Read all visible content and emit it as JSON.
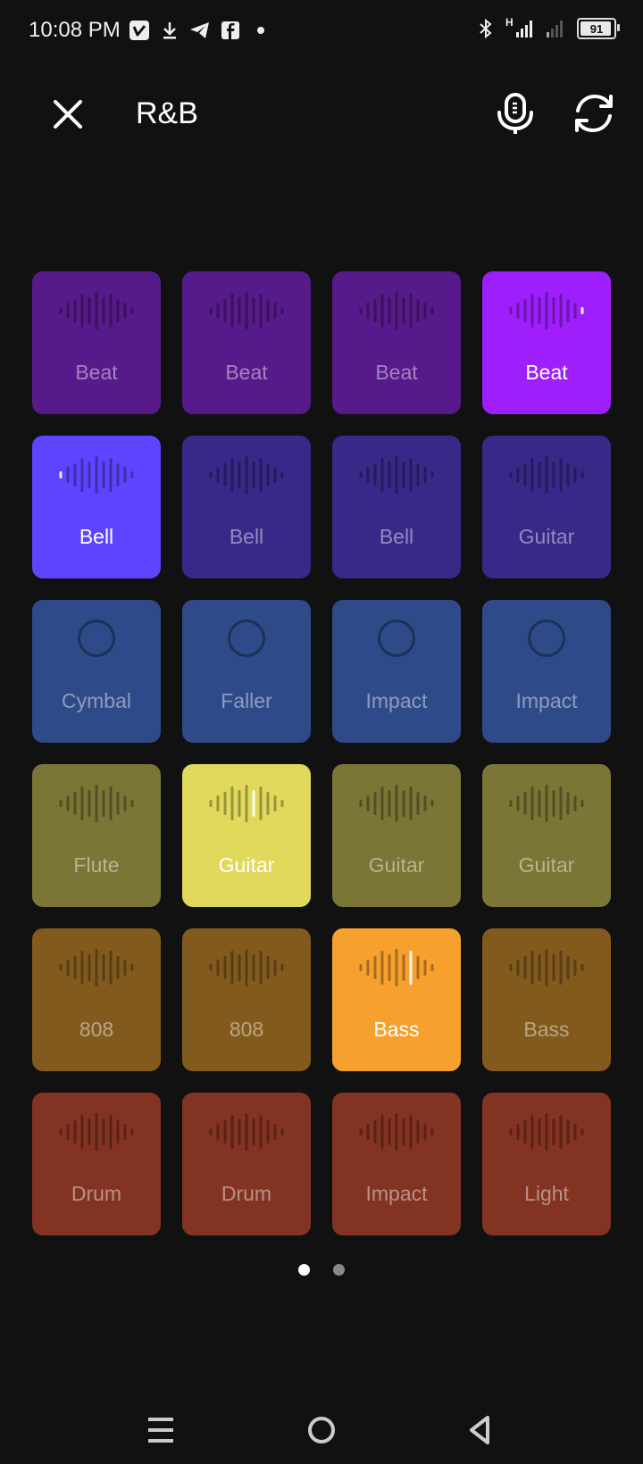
{
  "status_bar": {
    "time": "10:08 PM",
    "left_icons": [
      "vimeo-icon",
      "download-icon",
      "telegram-icon",
      "facebook-icon",
      "dot-icon"
    ],
    "network": "H",
    "battery": "91"
  },
  "header": {
    "title": "R&B",
    "close_icon": "close-icon",
    "mic_icon": "microphone-icon",
    "refresh_icon": "refresh-icon"
  },
  "pads": [
    {
      "label": "Beat",
      "color": "#571a8a",
      "active": false,
      "icon": "waveform"
    },
    {
      "label": "Beat",
      "color": "#571a8a",
      "active": false,
      "icon": "waveform"
    },
    {
      "label": "Beat",
      "color": "#571a8a",
      "active": false,
      "icon": "waveform"
    },
    {
      "label": "Beat",
      "color": "#9e1ffb",
      "active": true,
      "icon": "waveform"
    },
    {
      "label": "Bell",
      "color": "#5e44ff",
      "active": true,
      "icon": "waveform"
    },
    {
      "label": "Bell",
      "color": "#372988",
      "active": false,
      "icon": "waveform"
    },
    {
      "label": "Bell",
      "color": "#372988",
      "active": false,
      "icon": "waveform"
    },
    {
      "label": "Guitar",
      "color": "#372988",
      "active": false,
      "icon": "waveform"
    },
    {
      "label": "Cymbal",
      "color": "#2e4a88",
      "active": false,
      "icon": "circle"
    },
    {
      "label": "Faller",
      "color": "#2e4a88",
      "active": false,
      "icon": "circle"
    },
    {
      "label": "Impact",
      "color": "#2e4a88",
      "active": false,
      "icon": "circle"
    },
    {
      "label": "Impact",
      "color": "#2e4a88",
      "active": false,
      "icon": "circle"
    },
    {
      "label": "Flute",
      "color": "#7b7536",
      "active": false,
      "icon": "waveform"
    },
    {
      "label": "Guitar",
      "color": "#e1d95b",
      "active": true,
      "icon": "waveform"
    },
    {
      "label": "Guitar",
      "color": "#7b7536",
      "active": false,
      "icon": "waveform"
    },
    {
      "label": "Guitar",
      "color": "#7b7536",
      "active": false,
      "icon": "waveform"
    },
    {
      "label": "808",
      "color": "#835a1e",
      "active": false,
      "icon": "waveform"
    },
    {
      "label": "808",
      "color": "#835a1e",
      "active": false,
      "icon": "waveform"
    },
    {
      "label": "Bass",
      "color": "#f6a02e",
      "active": true,
      "icon": "waveform"
    },
    {
      "label": "Bass",
      "color": "#835a1e",
      "active": false,
      "icon": "waveform"
    },
    {
      "label": "Drum",
      "color": "#833322",
      "active": false,
      "icon": "waveform"
    },
    {
      "label": "Drum",
      "color": "#833322",
      "active": false,
      "icon": "waveform"
    },
    {
      "label": "Impact",
      "color": "#833322",
      "active": false,
      "icon": "waveform"
    },
    {
      "label": "Light",
      "color": "#833322",
      "active": false,
      "icon": "waveform"
    }
  ],
  "pagination": {
    "pages": 2,
    "current": 1
  },
  "nav": {
    "icons": [
      "menu-icon",
      "home-icon",
      "back-icon"
    ]
  }
}
